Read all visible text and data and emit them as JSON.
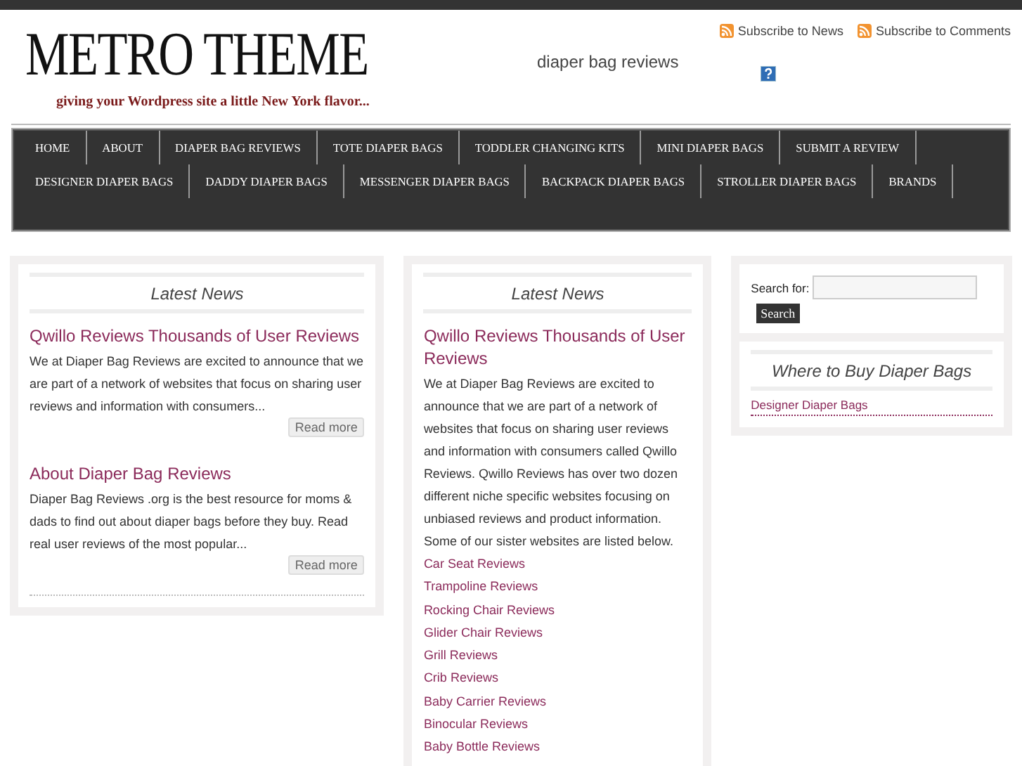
{
  "header": {
    "logo_title": "METRO THEME",
    "logo_tagline": "giving your Wordpress site a little New York flavor...",
    "site_name": "diaper bag reviews",
    "subscribe_links": [
      "Subscribe to News",
      "Subscribe to Comments"
    ]
  },
  "nav": {
    "items": [
      {
        "label": "HOME"
      },
      {
        "label": "ABOUT"
      },
      {
        "label": "DIAPER BAG REVIEWS"
      },
      {
        "label": "TOTE DIAPER BAGS"
      },
      {
        "label": "TODDLER CHANGING KITS"
      },
      {
        "label": "MINI DIAPER BAGS"
      },
      {
        "label": "SUBMIT A REVIEW"
      },
      {
        "label": "DESIGNER DIAPER BAGS"
      },
      {
        "label": "DADDY DIAPER BAGS"
      },
      {
        "label": "MESSENGER DIAPER BAGS"
      },
      {
        "label": "BACKPACK DIAPER BAGS"
      },
      {
        "label": "STROLLER DIAPER BAGS"
      },
      {
        "label": "BRANDS"
      }
    ]
  },
  "left_column": {
    "heading": "Latest News",
    "posts": [
      {
        "title": "Qwillo Reviews Thousands of User Reviews",
        "excerpt": "We at Diaper Bag Reviews are excited to announce that we are part of a network of websites that focus on sharing user reviews and information with consumers...",
        "read_more": "Read more"
      },
      {
        "title": "About Diaper Bag Reviews",
        "excerpt": "Diaper Bag Reviews .org is the best resource for moms & dads to find out about diaper bags before they buy.  Read real user reviews of the most popular...",
        "read_more": "Read more"
      }
    ]
  },
  "middle_column": {
    "heading": "Latest News",
    "post_title": "Qwillo Reviews Thousands of User Reviews",
    "body": "We at Diaper Bag Reviews are excited to announce that we are part of a network of websites that focus on sharing user reviews and information with consumers called Qwillo Reviews. Qwillo Reviews has over two dozen different niche specific websites focusing on unbiased reviews and product information. Some of our sister websites are listed below.",
    "links": [
      "Car Seat Reviews",
      "Trampoline Reviews",
      "Rocking Chair Reviews",
      "Glider Chair Reviews",
      "Grill Reviews",
      "Crib Reviews",
      "Baby Carrier Reviews",
      "Binocular Reviews",
      "Baby Bottle Reviews"
    ]
  },
  "right_column": {
    "search_label": "Search for:",
    "search_button": "Search",
    "widget_heading": "Where to Buy Diaper Bags",
    "widget_links": [
      "Designer Diaper Bags"
    ]
  }
}
